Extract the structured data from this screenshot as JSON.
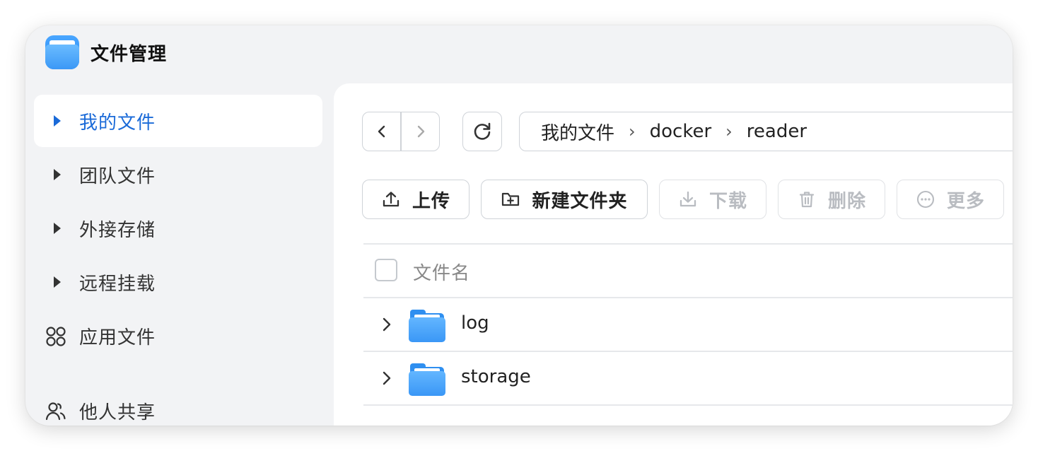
{
  "app": {
    "title": "文件管理",
    "icon": "file-manager-app-icon"
  },
  "sidebar": {
    "items": [
      {
        "label": "我的文件",
        "icon": "caret-right-icon",
        "active": true
      },
      {
        "label": "团队文件",
        "icon": "caret-right-icon"
      },
      {
        "label": "外接存储",
        "icon": "caret-right-icon"
      },
      {
        "label": "远程挂载",
        "icon": "caret-right-icon"
      },
      {
        "label": "应用文件",
        "icon": "apps-grid-icon"
      },
      {
        "label": "他人共享",
        "icon": "users-icon"
      }
    ]
  },
  "navigation": {
    "back_icon": "chevron-left-icon",
    "forward_icon": "chevron-right-icon",
    "refresh_icon": "refresh-icon"
  },
  "breadcrumb": {
    "segments": [
      "我的文件",
      "docker",
      "reader"
    ],
    "separator": "›"
  },
  "toolbar": {
    "upload": "上传",
    "new_folder": "新建文件夹",
    "download": "下载",
    "delete": "删除",
    "more": "更多"
  },
  "table": {
    "column_name": "文件名",
    "rows": [
      {
        "name": "log",
        "type": "folder"
      },
      {
        "name": "storage",
        "type": "folder"
      }
    ]
  },
  "colors": {
    "accent": "#1a6ad8",
    "folder": "#3a97f6",
    "disabled": "#b9bcc1",
    "background": "#f2f3f5"
  }
}
